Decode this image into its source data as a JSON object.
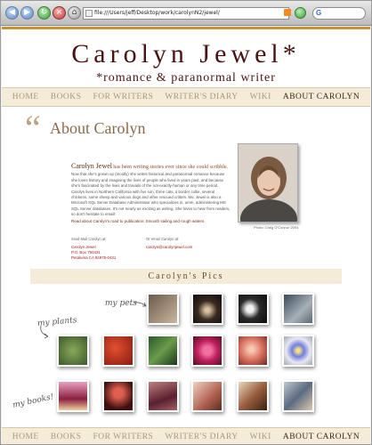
{
  "browser": {
    "url": "file:///Users/jeff/Desktop/work/carolynN2/jewel/",
    "back_icon": "back-arrow-icon",
    "forward_icon": "forward-arrow-icon",
    "reload_icon": "reload-icon",
    "stop_icon": "stop-icon",
    "home_icon": "home-icon"
  },
  "site": {
    "title": "Carolyn Jewel*",
    "tagline": "*romance & paranormal writer"
  },
  "nav": {
    "items": [
      {
        "label": "HOME"
      },
      {
        "label": "BOOKS"
      },
      {
        "label": "FOR WRITERS"
      },
      {
        "label": "WRITER'S DIARY"
      },
      {
        "label": "WIKI"
      },
      {
        "label": "ABOUT CAROLYN"
      }
    ],
    "active": "ABOUT CAROLYN"
  },
  "about": {
    "quote_mark": "“",
    "heading": "About Carolyn",
    "intro_lead": "Carolyn Jewel",
    "intro_lead_rest": "has been writing stories ever since she could scribble.",
    "body": "Now that she's grown up (mostly) she writes historical and paranormal romance because she loves history and imagining the lives of people who lived in years past, and because she's fascinated by the lives and travails of the not-exactly-human or any time period. Carolyn lives in Northern California with her son, three cats, a border collie, several chickens, some sheep and various dogs and other rescued critters. Ms. Jewel is also a Microsoft SQL Server Database Administrator who specializes in, umm, administering MS SQL Server databases. It's not nearly as exciting as writing. She loves to hear from readers, so don't hesitate to email!",
    "read_more": "Read about Carolyn's road to publication: Smooth sailing and rough waters.",
    "photo_credit": "Photo: Craig O'Connor 2004"
  },
  "contact": {
    "mail_label": "Snail Mail Carolyn at:",
    "mail_name": "Carolyn Jewel",
    "mail_box": "P.O. Box 750431",
    "mail_city": "Petaluma CA 94975-0431",
    "email_label": "Or email Carolyn at:",
    "email": "carolyn@carolynjewel.com"
  },
  "pics": {
    "heading": "Carolyn's Pics",
    "label_pets": "my pets",
    "label_plants": "my plants",
    "label_books": "my books!"
  }
}
